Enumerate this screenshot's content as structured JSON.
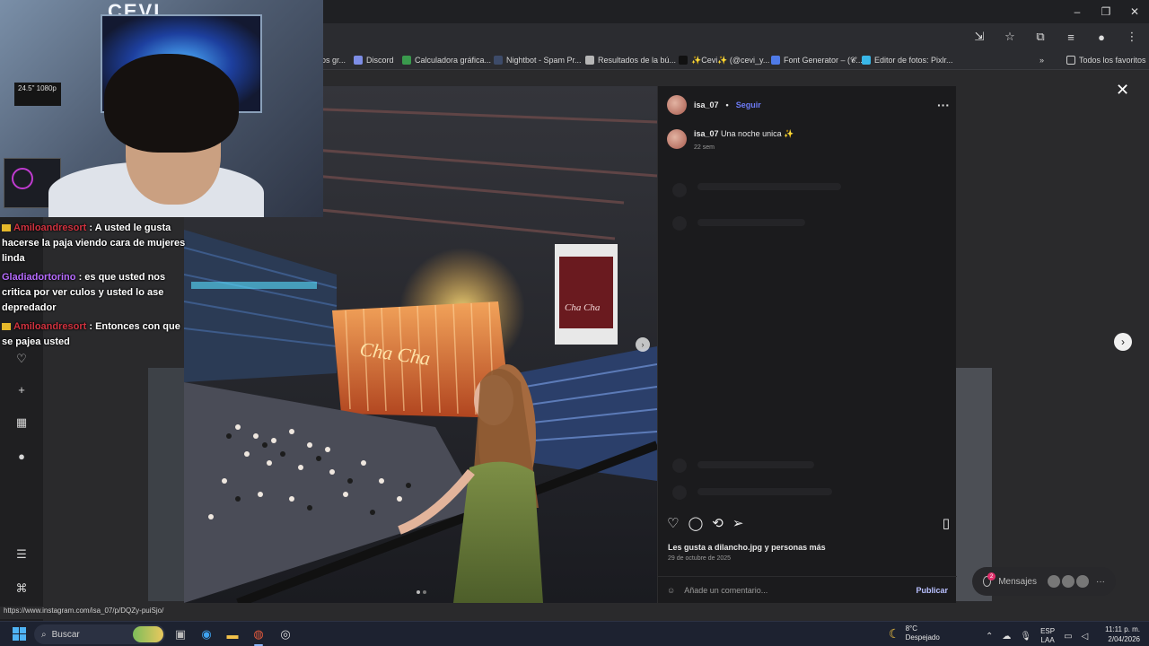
{
  "window": {
    "minimize_glyph": "–",
    "maximize_glyph": "❐",
    "close_glyph": "✕"
  },
  "toolbar": {
    "icons": [
      "install-app-icon",
      "bookmark-star-icon",
      "extensions-icon",
      "media-control-icon",
      "profile-avatar-icon",
      "kebab-menu-icon"
    ]
  },
  "bookmarks": [
    {
      "label": "os gr..."
    },
    {
      "label": "Discord"
    },
    {
      "label": "Calculadora gráfica..."
    },
    {
      "label": "Nightbot - Spam Pr..."
    },
    {
      "label": "Resultados de la bú..."
    },
    {
      "label": "✨Cevi✨ (@cevi_y..."
    },
    {
      "label": "Font Generator – (𝓒..."
    },
    {
      "label": "Editor de fotos: Pixlr..."
    }
  ],
  "bookmarks_more": "»",
  "bookmarks_folder": "Todos los favoritos",
  "webcam": {
    "brand": "CEVI",
    "monitor_label": "24.5\"\n1080p"
  },
  "chat": [
    {
      "user": "Amiloandresort",
      "message": ": A usted le gusta hacerse la paja viendo cara de mujeres linda"
    },
    {
      "user": "Gladiadortorino",
      "message": ": es que usted nos critica por ver culos y usted lo ase depredador"
    },
    {
      "user": "Amiloandresort",
      "message": ": Entonces con que se pajea usted"
    }
  ],
  "post": {
    "username": "isa_07",
    "separator": "•",
    "follow": "Seguir",
    "more": "···",
    "caption_user": "isa_07",
    "caption_text": "Una noche unica ✨",
    "caption_time": "22 sem",
    "likes_prefix": "Les gusta a",
    "likes_user": "dilancho.jpg",
    "likes_suffix": "y personas más",
    "date": "29 de octubre de 2025",
    "comment_placeholder": "Añade un comentario...",
    "publish": "Publicar",
    "photo_sign_left": "Cha Cha",
    "photo_poster": "Cha Cha"
  },
  "overlay": {
    "close": "✕",
    "next": "›"
  },
  "messages": {
    "label": "Mensajes",
    "badge": "2",
    "more": "···"
  },
  "status_url": "https://www.instagram.com/isa_07/p/DQZy-puiSjo/",
  "taskbar": {
    "search_label": "Buscar",
    "weather_temp": "8°C",
    "weather_desc": "Despejado",
    "lang_top": "ESP",
    "lang_bottom": "LAA",
    "time": "11:11 p. m.",
    "date": "2/04/2026"
  },
  "colors": {
    "follow": "#6d7bf7",
    "chat_user_1": "#d0323f",
    "chat_user_2": "#b76cff",
    "taskbar_bg": "#1d2230"
  }
}
